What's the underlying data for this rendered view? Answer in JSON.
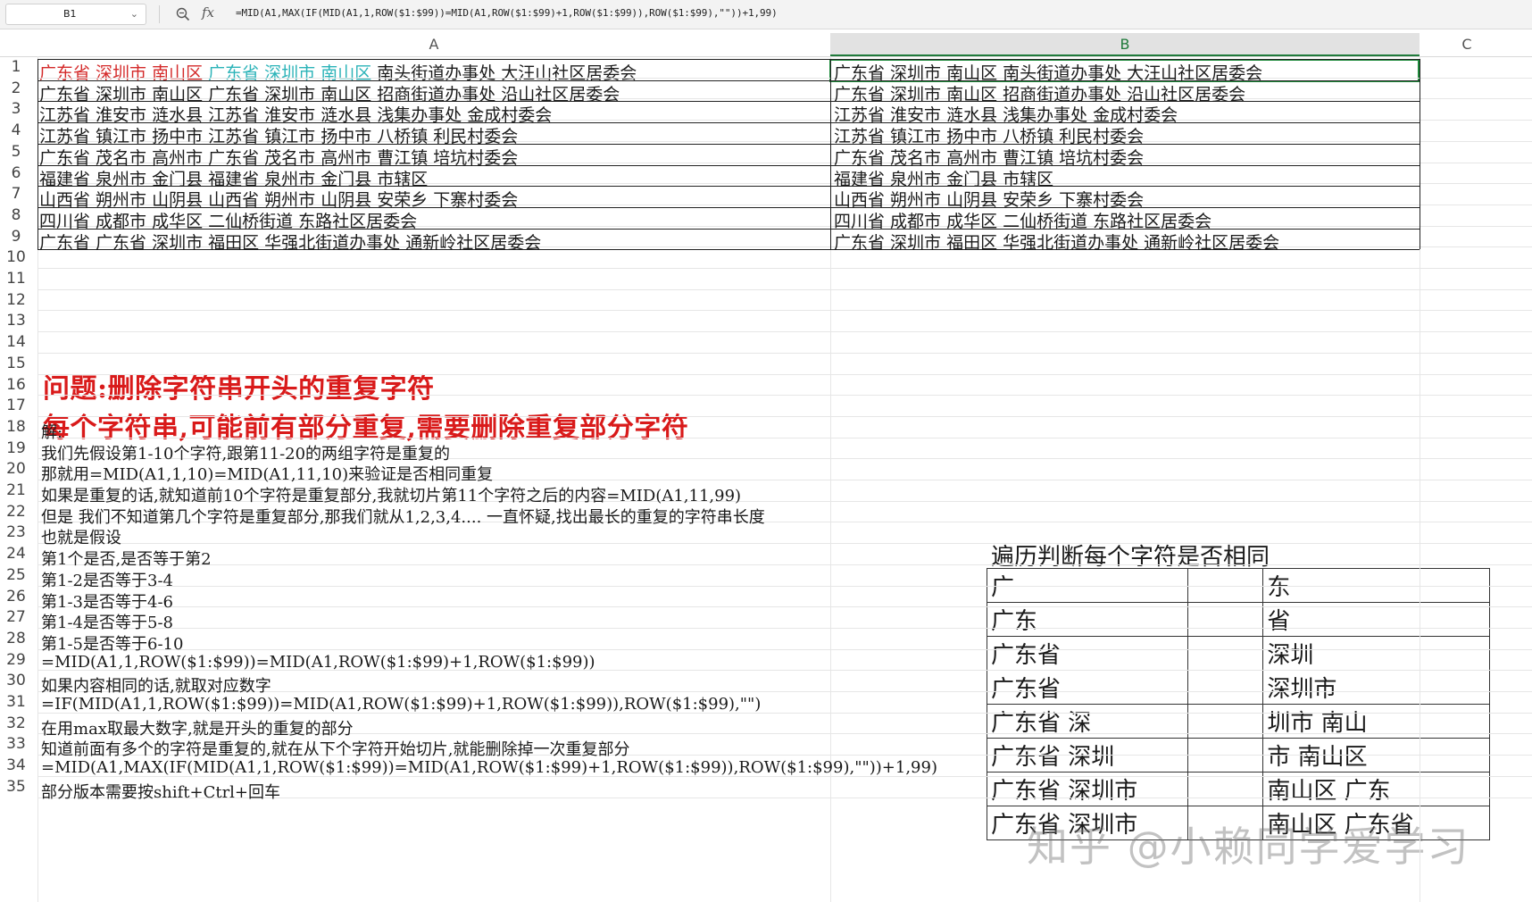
{
  "formula_bar": {
    "name_box": "B1",
    "formula": "=MID(A1,MAX(IF(MID(A1,1,ROW($1:$99))=MID(A1,ROW($1:$99)+1,ROW($1:$99)),ROW($1:$99),\"\"))+1,99)"
  },
  "columns": [
    "A",
    "B",
    "C"
  ],
  "rows": [
    "1",
    "2",
    "3",
    "4",
    "5",
    "6",
    "7",
    "8",
    "9",
    "10",
    "11",
    "12",
    "13",
    "14",
    "15",
    "16",
    "17",
    "18",
    "19",
    "20",
    "21",
    "22",
    "23",
    "24",
    "25",
    "26",
    "27",
    "28",
    "29",
    "30",
    "31",
    "32",
    "33",
    "34",
    "35"
  ],
  "row1_a": {
    "seg1": "广东省 深圳市 南山区 ",
    "seg2": "广东省 深圳市 南山区 ",
    "seg3": "南头街道办事处 大汪山社区居委会",
    "seg1_color": "#d42a2a",
    "seg2_color": "#2bb3b8"
  },
  "col_a": [
    "广东省 深圳市 南山区 广东省 深圳市 南山区 招商街道办事处 沿山社区居委会",
    "江苏省 淮安市 涟水县 江苏省 淮安市 涟水县 浅集办事处 金成村委会",
    "江苏省 镇江市 扬中市 江苏省 镇江市 扬中市 八桥镇 利民村委会",
    "广东省 茂名市 高州市 广东省 茂名市 高州市 曹江镇 培坑村委会",
    "福建省 泉州市 金门县 福建省 泉州市 金门县 市辖区",
    "山西省 朔州市 山阴县 山西省 朔州市 山阴县 安荣乡 下寨村委会",
    "四川省 成都市 成华区 二仙桥街道 东路社区居委会",
    "广东省 广东省 深圳市 福田区 华强北街道办事处 通新岭社区居委会"
  ],
  "col_b": [
    "广东省 深圳市 南山区 南头街道办事处 大汪山社区居委会",
    "广东省 深圳市 南山区 招商街道办事处 沿山社区居委会",
    "江苏省 淮安市 涟水县 浅集办事处 金成村委会",
    "江苏省 镇江市 扬中市 八桥镇 利民村委会",
    "广东省 茂名市 高州市 曹江镇 培坑村委会",
    "福建省 泉州市 金门县 市辖区",
    "山西省 朔州市 山阴县 安荣乡 下寨村委会",
    "四川省 成都市 成华区 二仙桥街道 东路社区居委会",
    "广东省 深圳市 福田区 华强北街道办事处 通新岭社区居委会"
  ],
  "question": {
    "line1": "问题:删除字符串开头的重复字符",
    "line2": "每个字符串,可能前有部分重复,需要删除重复部分字符"
  },
  "solution": [
    "解:",
    "我们先假设第1-10个字符,跟第11-20的两组字符是重复的",
    "那就用=MID(A1,1,10)=MID(A1,11,10)来验证是否相同重复",
    "如果是重复的话,就知道前10个字符是重复部分,我就切片第11个字符之后的内容=MID(A1,11,99)",
    "但是 我们不知道第几个字符是重复部分,那我们就从1,2,3,4.... 一直怀疑,找出最长的重复的字符串长度",
    "也就是假设",
    "第1个是否,是否等于第2",
    "第1-2是否等于3-4",
    "第1-3是否等于4-6",
    "第1-4是否等于5-8",
    "第1-5是否等于6-10",
    "=MID(A1,1,ROW($1:$99))=MID(A1,ROW($1:$99)+1,ROW($1:$99))",
    "如果内容相同的话,就取对应数字",
    "=IF(MID(A1,1,ROW($1:$99))=MID(A1,ROW($1:$99)+1,ROW($1:$99)),ROW($1:$99),\"\")",
    "在用max取最大数字,就是开头的重复的部分",
    "知道前面有多个的字符是重复的,就在从下个字符开始切片,就能删除掉一次重复部分",
    "=MID(A1,MAX(IF(MID(A1,1,ROW($1:$99))=MID(A1,ROW($1:$99)+1,ROW($1:$99)),ROW($1:$99),\"\"))+1,99)",
    "部分版本需要按shift+Ctrl+回车"
  ],
  "side_table": {
    "title": "遍历判断每个字符是否相同",
    "rows": [
      [
        "广",
        "",
        "东"
      ],
      [
        "广东",
        "",
        "省"
      ],
      [
        "广东省",
        "",
        " 深圳"
      ],
      [
        "广东省",
        "",
        "深圳市"
      ],
      [
        "广东省 深",
        "",
        "圳市 南山"
      ],
      [
        "广东省 深圳",
        "",
        "市 南山区"
      ],
      [
        "广东省 深圳市",
        "",
        " 南山区 广东"
      ],
      [
        "广东省 深圳市",
        "",
        "南山区 广东省"
      ]
    ]
  },
  "watermark": "知乎 @小赖同学爱学习"
}
